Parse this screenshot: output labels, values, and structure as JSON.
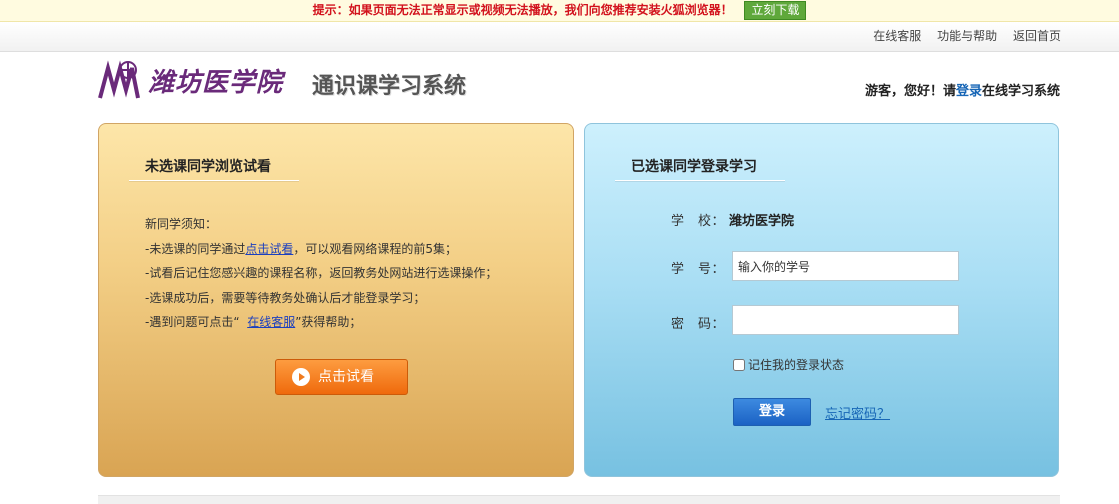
{
  "notice": {
    "message": "提示：如果页面无法正常显示或视频无法播放，我们向您推荐安装火狐浏览器！",
    "download_label": "立刻下载",
    "color": "#d2121d"
  },
  "toplinks": [
    "在线客服",
    "功能与帮助",
    "返回首页"
  ],
  "header": {
    "school_name": "潍坊医学院",
    "system_name": "通识课学习系统",
    "greet_prefix": "游客，您好！请",
    "greet_login": "登录",
    "greet_suffix": "在线学习系统"
  },
  "left_panel": {
    "title": "未选课同学浏览试看",
    "notes": {
      "intro": "新同学须知：",
      "line1_pre": "-未选课的同学通过",
      "line1_link": "点击试看",
      "line1_post": "，可以观看网络课程的前5集；",
      "line2": "-试看后记住您感兴趣的课程名称，返回教务处网站进行选课操作；",
      "line3": "-选课成功后，需要等待教务处确认后才能登录学习；",
      "line4_pre": "-遇到问题可点击“",
      "line4_link": "在线客服",
      "line4_post": "”获得帮助；"
    },
    "try_button": "点击试看"
  },
  "right_panel": {
    "title": "已选课同学登录学习",
    "school_label": "学　校：",
    "school_value": "潍坊医学院",
    "id_label": "学　号：",
    "id_value": "输入你的学号",
    "pwd_label": "密　码：",
    "pwd_value": "",
    "remember_label": "记住我的登录状态",
    "login_button": "登录",
    "forgot_link": "忘记密码？"
  }
}
